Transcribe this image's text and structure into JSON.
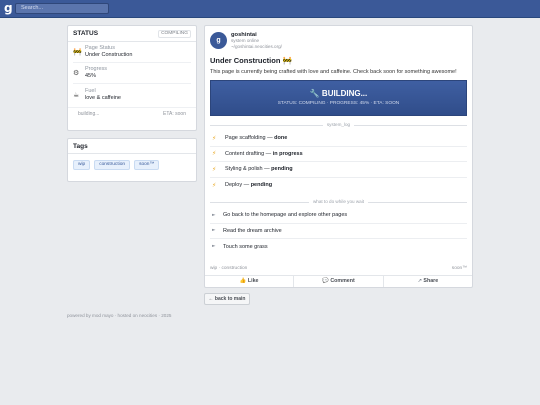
{
  "topbar": {
    "logo": "g",
    "search_placeholder": "Search..."
  },
  "status_card": {
    "title": "STATUS",
    "badge": "COMPILING",
    "rows": [
      {
        "icon": "construction-icon",
        "glyph": "🚧",
        "label": "Page Status",
        "value": "Under Construction"
      },
      {
        "icon": "gear-icon",
        "glyph": "⚙",
        "label": "Progress",
        "value": "45%"
      },
      {
        "icon": "coffee-icon",
        "glyph": "☕",
        "label": "Fuel",
        "value": "love & caffeine"
      }
    ],
    "footer_left": "building...",
    "footer_right": "ETA: soon"
  },
  "tags_card": {
    "title": "Tags",
    "tags": [
      "wip",
      "construction",
      "soon™"
    ]
  },
  "post": {
    "avatar": "g",
    "author": "goshintai",
    "presence": "system online",
    "url": "~/goshintai.neocities.org/",
    "title": "Under Construction 🚧",
    "body": "This page is currently being crafted with love and caffeine. Check back soon for something awesome!",
    "banner_title": "🔧 BUILDING...",
    "banner_subtitle": "STATUS: COMPILING · PROGRESS: 45% · ETA: SOON",
    "log_divider": "system_log",
    "log": [
      {
        "task": "Page scaffolding —",
        "status": "done"
      },
      {
        "task": "Content drafting —",
        "status": "in progress"
      },
      {
        "task": "Styling & polish —",
        "status": "pending"
      },
      {
        "task": "Deploy —",
        "status": "pending"
      }
    ],
    "todo_divider": "what to do while you wait",
    "todo": [
      "Go back to the homepage and explore other pages",
      "Read the dream archive",
      "Touch some grass"
    ],
    "meta_left": "wip · construction",
    "meta_right": "soon™",
    "actions": [
      {
        "icon": "👍",
        "label": "Like"
      },
      {
        "icon": "💬",
        "label": "Comment"
      },
      {
        "icon": "↗",
        "label": "Share"
      }
    ]
  },
  "back_button": "← back to main",
  "footer": "powered by mod mayo · hosted on neocities · 2025"
}
